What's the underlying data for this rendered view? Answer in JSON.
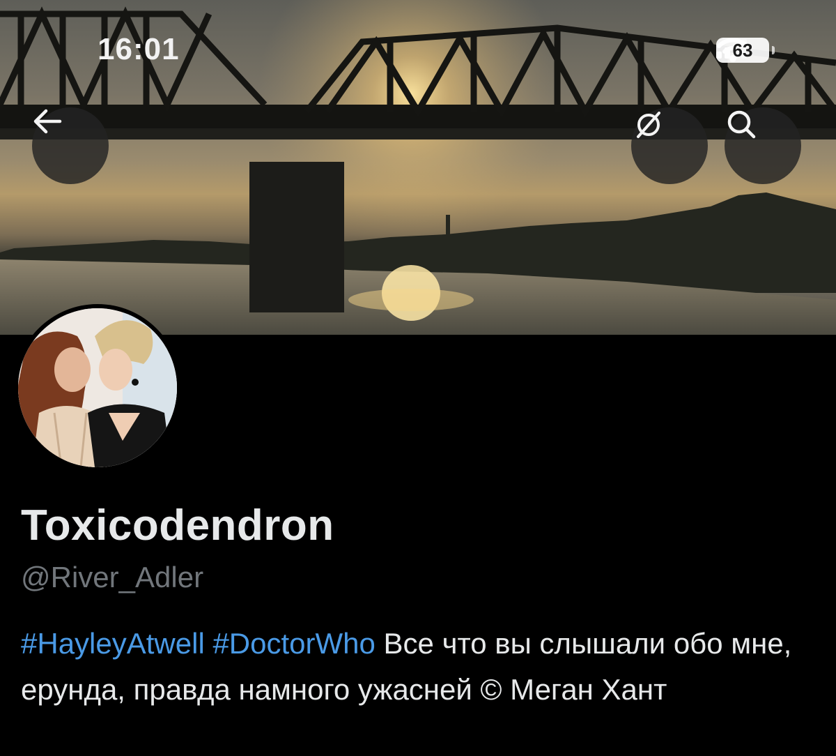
{
  "status_bar": {
    "time": "16:01",
    "battery": "63"
  },
  "nav": {
    "back_icon": "arrow-left-icon",
    "translate_icon": "translate-icon",
    "search_icon": "search-icon"
  },
  "profile": {
    "display_name": "Toxicodendron",
    "handle": "@River_Adler",
    "bio": {
      "hashtags": [
        "#HayleyAtwell",
        "#DoctorWho"
      ],
      "text": "Все что вы слышали обо мне, ерунда, правда намного ужасней © Меган Хант"
    }
  },
  "colors": {
    "background": "#000000",
    "accent_link": "#4a9ae6",
    "secondary_text": "#71767b",
    "primary_text": "#e7e9ea"
  }
}
